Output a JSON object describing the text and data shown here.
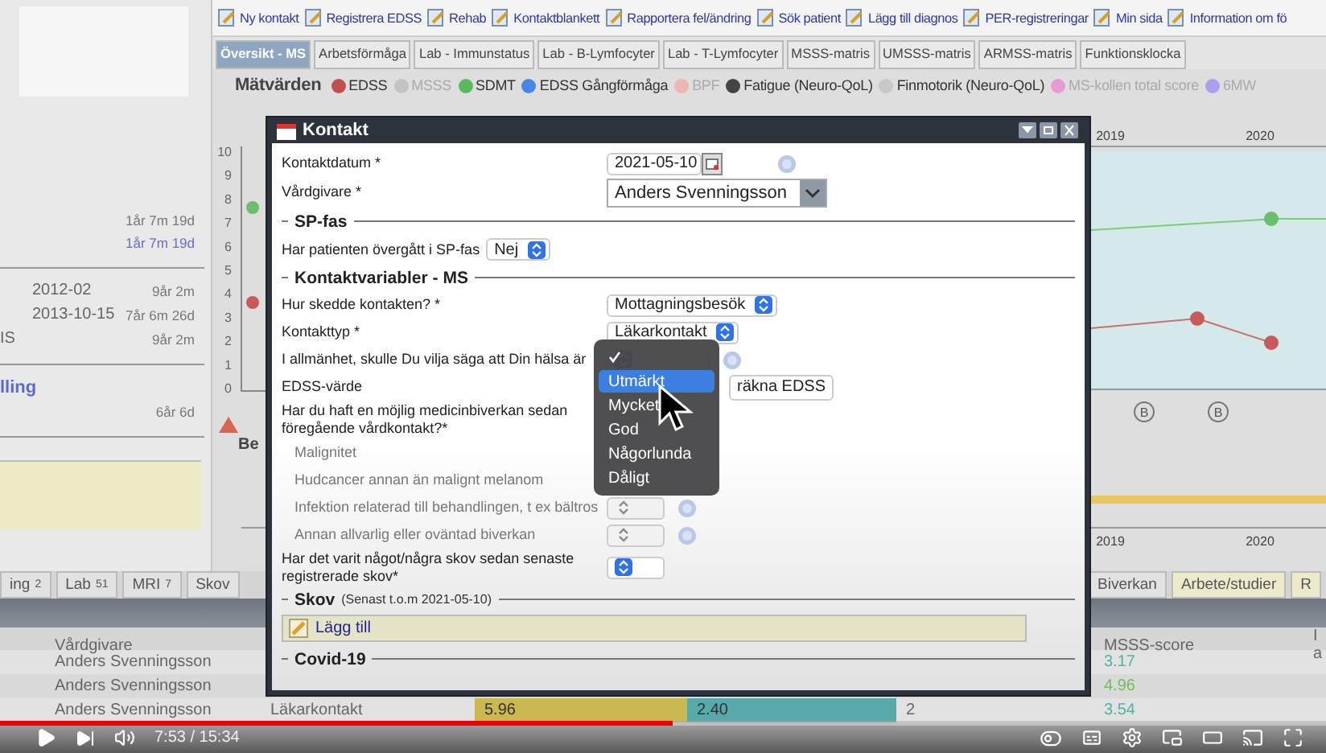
{
  "toolbar": [
    {
      "label": "Ny kontakt"
    },
    {
      "label": "Registrera EDSS"
    },
    {
      "label": "Rehab"
    },
    {
      "label": "Kontaktblankett"
    },
    {
      "label": "Rapportera fel/ändring"
    },
    {
      "label": "Sök patient"
    },
    {
      "label": "Lägg till diagnos"
    },
    {
      "label": "PER-registreringar"
    },
    {
      "label": "Min sida"
    },
    {
      "label": "Information om fö"
    }
  ],
  "tabs": [
    {
      "label": "Översikt - MS",
      "selected": true
    },
    {
      "label": "Arbetsförmåga",
      "selected": false
    },
    {
      "label": "Lab - Immunstatus",
      "selected": false
    },
    {
      "label": "Lab - B-Lymfocyter",
      "selected": false
    },
    {
      "label": "Lab - T-Lymfocyter",
      "selected": false
    },
    {
      "label": "MSSS-matris",
      "selected": false
    },
    {
      "label": "UMSSS-matris",
      "selected": false
    },
    {
      "label": "ARMSS-matris",
      "selected": false
    },
    {
      "label": "Funktionsklocka",
      "selected": false
    }
  ],
  "legend": {
    "title": "Mätvärden",
    "items": [
      {
        "label": "EDSS",
        "color": "#c0504d",
        "enabled": true
      },
      {
        "label": "MSSS",
        "color": "#c4c4c4",
        "enabled": false
      },
      {
        "label": "SDMT",
        "color": "#5cb85c",
        "enabled": true
      },
      {
        "label": "EDSS Gångförmåga",
        "color": "#4a86e8",
        "enabled": true
      },
      {
        "label": "BPF",
        "color": "#f2b3b3",
        "enabled": false
      },
      {
        "label": "Fatigue (Neuro-QoL)",
        "color": "#444444",
        "enabled": true
      },
      {
        "label": "Finmotorik (Neuro-QoL)",
        "color": "#c8c8c8",
        "enabled": true
      },
      {
        "label": "MS-kollen total score",
        "color": "#e89ad6",
        "enabled": false
      },
      {
        "label": "6MW",
        "color": "#a9a0f0",
        "enabled": false
      }
    ]
  },
  "left_panel": {
    "groups": [
      {
        "rows": [
          {
            "value": "1år 7m 19d",
            "linked": false
          },
          {
            "value": "1år 7m 19d",
            "linked": true
          }
        ]
      },
      {
        "rows": [
          {
            "label": "2012-02",
            "value": "9år 2m",
            "linked": false
          },
          {
            "label": "2013-10-15",
            "value": "7år 6m 26d",
            "linked": false
          },
          {
            "label": "IS",
            "value": "9år 2m",
            "linked": false
          }
        ]
      },
      {
        "heading": "lling",
        "rows": [
          {
            "value": "6år 6d",
            "linked": false
          }
        ]
      }
    ]
  },
  "chart": {
    "y_ticks": [
      "10",
      "9",
      "8",
      "7",
      "6",
      "5",
      "4",
      "3",
      "2",
      "1",
      "0"
    ],
    "top_years": [
      "2019",
      "2020"
    ],
    "bottom_years": [
      "2019",
      "2020"
    ],
    "markers": [
      "B",
      "B"
    ],
    "side_label": "Be"
  },
  "bottom_tabs_left": [
    {
      "label": "ing",
      "count": "2"
    },
    {
      "label": "Lab",
      "count": "51"
    },
    {
      "label": "MRI",
      "count": "7"
    },
    {
      "label": "Skov"
    }
  ],
  "bottom_tabs_right": [
    {
      "label": "Biverkan"
    },
    {
      "label": "Arbete/studier"
    },
    {
      "label": "R"
    }
  ],
  "table": {
    "columns": {
      "vardgivare": "Vårdgivare",
      "msss_score": "MSSS-score",
      "column_7": "I a"
    },
    "rows": [
      {
        "vardgivare": "Anders Svenningsson",
        "msss_score": {
          "text": "3.17",
          "color": "#4fb3a6"
        }
      },
      {
        "vardgivare": "Anders Svenningsson",
        "msss_score": {
          "text": "4.96",
          "color": "#6cbf5a"
        }
      },
      {
        "vardgivare": "Anders Svenningsson",
        "column_2": "Läkarkontakt",
        "column_3": {
          "text": "5.96",
          "color": "#c9b94e"
        },
        "column_4": {
          "text": "2.40",
          "color": "#58a9aa"
        },
        "column_5": "2",
        "msss_score": {
          "text": "3.54",
          "color": "#4fb3a6"
        }
      }
    ]
  },
  "dialog": {
    "title": "Kontakt",
    "items": [
      {
        "kind": "date",
        "label": "Kontaktdatum *",
        "value": "2021-05-10",
        "help": true
      },
      {
        "kind": "combo",
        "label": "Vårdgivare *",
        "value": "Anders Svenningsson",
        "help": false
      },
      {
        "kind": "section",
        "title": "SP-fas"
      },
      {
        "kind": "inline_select",
        "label": "Har patienten övergått i SP-fas",
        "value": "Nej",
        "help": false
      },
      {
        "kind": "section",
        "title": "Kontaktvariabler - MS"
      },
      {
        "kind": "select",
        "label": "Hur skedde kontakten? *",
        "value": "Mottagningsbesök",
        "help": false
      },
      {
        "kind": "select",
        "label": "Kontakttyp *",
        "value": "Läkarkontakt",
        "help": false
      },
      {
        "kind": "select",
        "label": "I allmänhet, skulle Du vilja säga att Din hälsa är",
        "help": true
      },
      {
        "kind": "button",
        "label": "EDSS-värde",
        "value": "räkna EDSS",
        "help": false
      },
      {
        "kind": "text",
        "label": "Har du haft en möjlig medicinbiverkan sedan föregående vårdkontakt?*"
      },
      {
        "kind": "sub",
        "label": "Malignitet"
      },
      {
        "kind": "sub",
        "label": "Hudcancer annan än malignt melanom"
      },
      {
        "kind": "sub_select",
        "label": "Infektion relaterad till behandlingen, t ex bältros",
        "disabled": true,
        "help": true
      },
      {
        "kind": "sub_select",
        "label": "Annan allvarlig eller oväntad biverkan",
        "disabled": true,
        "help": true
      },
      {
        "kind": "select",
        "label": "Har det varit något/några skov sedan senaste registrerade skov*",
        "help": false
      },
      {
        "kind": "section",
        "title": "Skov",
        "note": "(Senast t.o.m 2021-05-10)"
      },
      {
        "kind": "add",
        "label": "Lägg till"
      },
      {
        "kind": "section",
        "title": "Covid-19"
      }
    ],
    "menu": [
      {
        "checked": true,
        "highlighted": false
      },
      {
        "label": "Utmärkt",
        "checked": false,
        "highlighted": true
      },
      {
        "label": "Mycket",
        "checked": false,
        "highlighted": false
      },
      {
        "label": "God",
        "checked": false,
        "highlighted": false
      },
      {
        "label": "Någorlunda",
        "checked": false,
        "highlighted": false
      },
      {
        "label": "Dåligt",
        "checked": false,
        "highlighted": false
      }
    ]
  },
  "player": {
    "time": "7:53 / 15:34",
    "level": 0.507
  }
}
